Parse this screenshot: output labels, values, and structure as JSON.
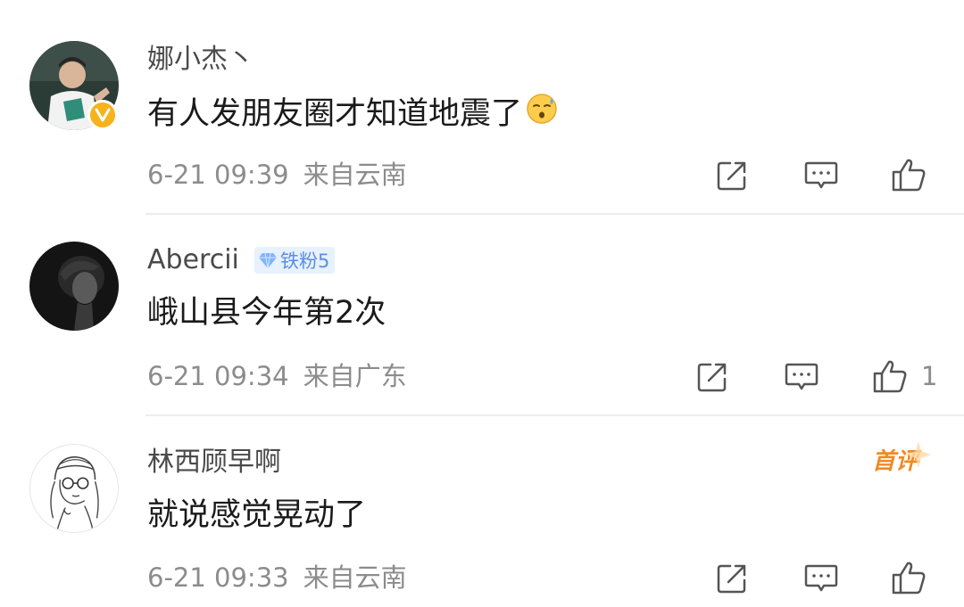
{
  "comments": [
    {
      "username": "娜小杰丶",
      "text": "有人发朋友圈才知道地震了",
      "time": "6-21 09:39",
      "source": "来自云南",
      "verified": true,
      "emoji": "sweat-smile-emoji",
      "avatar_icon": "user-photo-avatar"
    },
    {
      "username": "Abercii",
      "badge": "铁粉5",
      "text": "峨山县今年第2次",
      "time": "6-21 09:34",
      "source": "来自广东",
      "like_count": "1",
      "avatar_icon": "dark-portrait-avatar"
    },
    {
      "username": "林西顾早啊",
      "first_label": "首评",
      "text": "就说感觉晃动了",
      "time": "6-21 09:33",
      "source": "来自云南",
      "avatar_icon": "line-drawing-avatar"
    }
  ],
  "icons": {
    "share": "share-icon",
    "reply": "comment-icon",
    "like": "thumbs-up-icon"
  },
  "colors": {
    "verified": "#f6b31b",
    "fan_badge": "#5a8fe0",
    "first_comment": "#f08a24",
    "meta_text": "#8c8c8c"
  }
}
